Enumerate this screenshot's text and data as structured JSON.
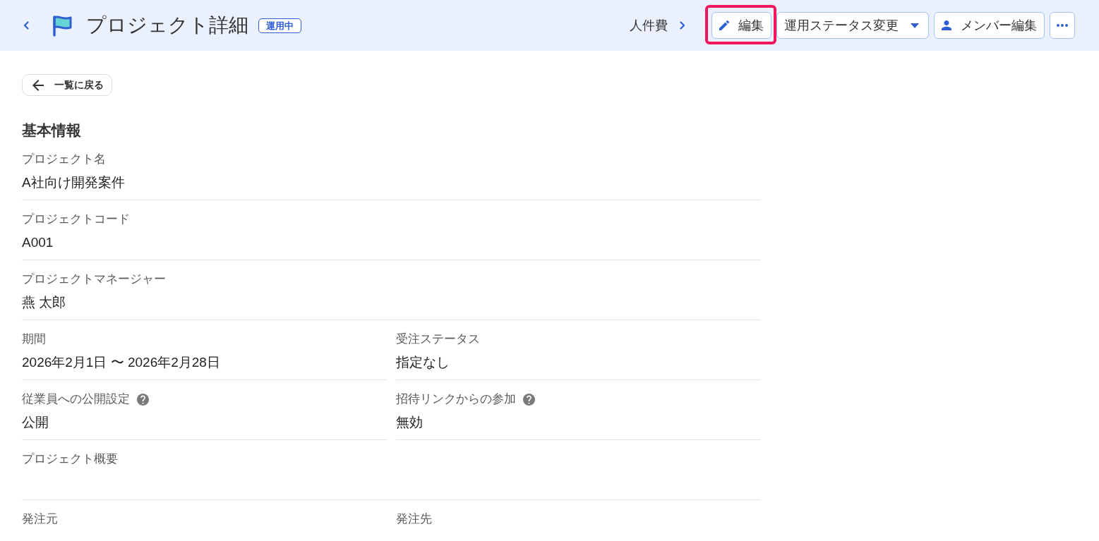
{
  "header": {
    "title": "プロジェクト詳細",
    "status_badge": "運用中",
    "breadcrumb": "人件費",
    "edit_button": {
      "label": "編集",
      "highlighted": true
    },
    "status_button": {
      "label": "運用ステータス変更"
    },
    "member_button": {
      "label": "メンバー編集"
    }
  },
  "back_button": {
    "label": "一覧に戻る"
  },
  "section": {
    "title": "基本情報",
    "rows": [
      {
        "fields": [
          {
            "label": "プロジェクト名",
            "value": "A社向け開発案件",
            "help": false
          }
        ]
      },
      {
        "fields": [
          {
            "label": "プロジェクトコード",
            "value": "A001",
            "help": false
          }
        ]
      },
      {
        "fields": [
          {
            "label": "プロジェクトマネージャー",
            "value": "燕 太郎",
            "help": false
          }
        ]
      },
      {
        "fields": [
          {
            "label": "期間",
            "value": "2026年2月1日 〜 2026年2月28日",
            "help": false
          },
          {
            "label": "受注ステータス",
            "value": "指定なし",
            "help": false
          }
        ]
      },
      {
        "fields": [
          {
            "label": "従業員への公開設定",
            "value": "公開",
            "help": true
          },
          {
            "label": "招待リンクからの参加",
            "value": "無効",
            "help": true
          }
        ]
      },
      {
        "fields": [
          {
            "label": "プロジェクト概要",
            "help": false
          }
        ]
      },
      {
        "fields": [
          {
            "label": "発注元",
            "help": false
          },
          {
            "label": "発注先",
            "help": false
          }
        ]
      }
    ]
  }
}
